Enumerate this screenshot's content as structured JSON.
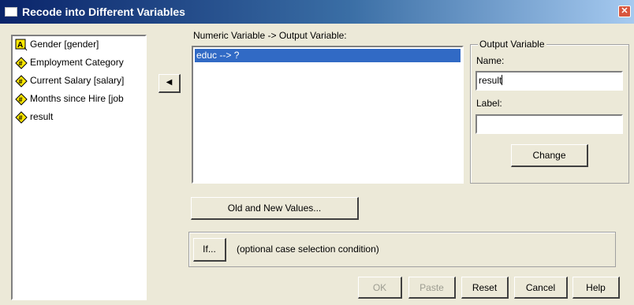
{
  "window": {
    "title": "Recode into Different Variables"
  },
  "variables": [
    {
      "label": "Gender [gender]",
      "type": "string",
      "icon": "string-var-icon"
    },
    {
      "label": "Employment Category",
      "type": "numeric",
      "icon": "numeric-var-icon"
    },
    {
      "label": "Current Salary [salary]",
      "type": "numeric",
      "icon": "numeric-var-icon"
    },
    {
      "label": "Months since Hire [job",
      "type": "numeric",
      "icon": "numeric-var-icon"
    },
    {
      "label": "result",
      "type": "numeric",
      "icon": "numeric-var-icon"
    }
  ],
  "move_button": {
    "glyph": "◀",
    "icon": "left-arrow-icon"
  },
  "mapping": {
    "header": "Numeric Variable -> Output Variable:",
    "items": [
      {
        "text": "educ --> ?",
        "selected": true
      }
    ]
  },
  "output_variable": {
    "legend": "Output Variable",
    "name_label": "Name:",
    "name_value": "result",
    "label_label": "Label:",
    "label_value": "",
    "change_button": "Change"
  },
  "old_new_button": "Old and New Values...",
  "if_section": {
    "button": "If...",
    "description": "(optional case selection condition)"
  },
  "buttons": {
    "ok": "OK",
    "paste": "Paste",
    "reset": "Reset",
    "cancel": "Cancel",
    "help": "Help"
  },
  "colors": {
    "titlebar_start": "#0a246a",
    "selection": "#316ac5",
    "dialog_bg": "#ece9d8",
    "disabled_text": "#9d9d91"
  }
}
